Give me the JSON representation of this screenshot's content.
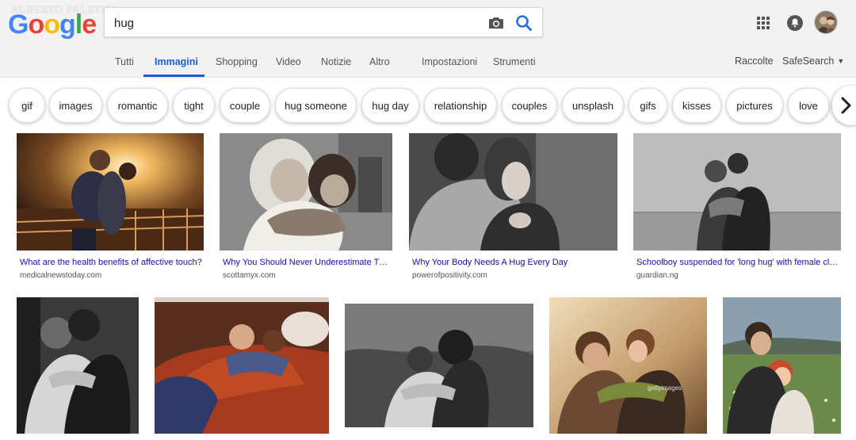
{
  "watermark": "ALBERTO PALSTILL",
  "logo": {
    "letters": [
      "G",
      "o",
      "o",
      "g",
      "l",
      "e"
    ],
    "colors": [
      "#4285f4",
      "#ea4335",
      "#fbbc05",
      "#4285f4",
      "#34a853",
      "#ea4335"
    ]
  },
  "search": {
    "query": "hug",
    "placeholder": ""
  },
  "icons": {
    "camera": "camera-icon",
    "search": "magnifier-icon",
    "apps": "apps-grid-icon",
    "notifications": "bell-icon",
    "next": "chevron-right-icon"
  },
  "tabs": [
    {
      "label": "Tutti"
    },
    {
      "label": "Immagini",
      "active": true
    },
    {
      "label": "Shopping"
    },
    {
      "label": "Video"
    },
    {
      "label": "Notizie"
    },
    {
      "label": "Altro"
    },
    {
      "label": "Impostazioni"
    },
    {
      "label": "Strumenti"
    }
  ],
  "right_links": {
    "raccolte": "Raccolte",
    "safesearch": "SafeSearch"
  },
  "chips": [
    "gif",
    "images",
    "romantic",
    "tight",
    "couple",
    "hug someone",
    "hug day",
    "relationship",
    "couples",
    "unsplash",
    "gifs",
    "kisses",
    "pictures",
    "love"
  ],
  "results_row1": [
    {
      "title": "What are the health benefits of affective touch?",
      "source": "medicalnewstoday.com"
    },
    {
      "title": "Why You Should Never Underestimate Th...",
      "source": "scottamyx.com"
    },
    {
      "title": "Why Your Body Needs A Hug Every Day",
      "source": "powerofpositivity.com"
    },
    {
      "title": "Schoolboy suspended for 'long hug' with female cla...",
      "source": "guardian.ng"
    }
  ],
  "results_row2": [
    {
      "caption": ""
    },
    {
      "caption": ""
    },
    {
      "caption": ""
    },
    {
      "caption": "gettyimages"
    },
    {
      "caption": ""
    }
  ],
  "colors": {
    "accent": "#1a5fd0",
    "title_link": "#1a0dab",
    "header_bg": "#f2f2f2"
  }
}
